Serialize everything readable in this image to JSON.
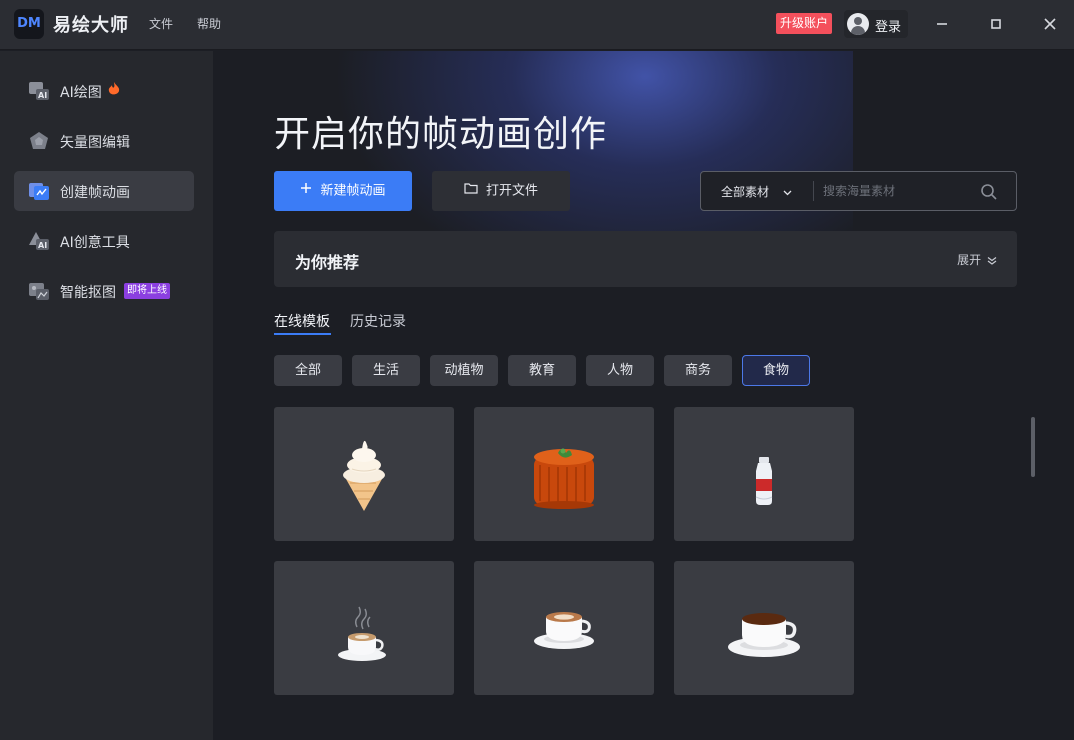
{
  "app": {
    "logo": "DM",
    "title": "易绘大师",
    "menu": [
      "文件",
      "帮助"
    ],
    "upgrade_label": "升级账户",
    "login_label": "登录",
    "window_controls": [
      "minimize-icon",
      "maximize-icon",
      "close-icon"
    ]
  },
  "sidebar": {
    "items": [
      {
        "label": "AI绘图",
        "icon": "ai-paint-icon",
        "hot": true
      },
      {
        "label": "矢量图编辑",
        "icon": "vector-icon"
      },
      {
        "label": "创建帧动画",
        "icon": "animation-icon",
        "active": true
      },
      {
        "label": "AI创意工具",
        "icon": "ai-tools-icon"
      },
      {
        "label": "智能抠图",
        "icon": "cutout-icon",
        "badge": "即将上线"
      }
    ]
  },
  "main": {
    "hero_title": "开启你的帧动画创作",
    "new_button": "新建帧动画",
    "open_button": "打开文件",
    "search": {
      "category": "全部素材",
      "placeholder": "搜索海量素材"
    },
    "recommend": {
      "title": "为你推荐",
      "expand_label": "展开"
    },
    "tabs": [
      {
        "label": "在线模板",
        "active": true
      },
      {
        "label": "历史记录"
      }
    ],
    "categories": [
      {
        "label": "全部"
      },
      {
        "label": "生活"
      },
      {
        "label": "动植物"
      },
      {
        "label": "教育"
      },
      {
        "label": "人物"
      },
      {
        "label": "商务"
      },
      {
        "label": "食物",
        "active": true
      }
    ],
    "templates": [
      {
        "icon": "ice-cream-icon"
      },
      {
        "icon": "cake-icon"
      },
      {
        "icon": "bottle-icon"
      },
      {
        "icon": "steaming-coffee-icon"
      },
      {
        "icon": "latte-cup-icon"
      },
      {
        "icon": "coffee-cup-icon"
      }
    ]
  },
  "colors": {
    "accent": "#3b7cf6",
    "upgrade": "#f4505c",
    "badge": "#8b3fe0",
    "background": "#1c1e24",
    "sidebar": "#26282d",
    "card": "#3a3c42"
  }
}
